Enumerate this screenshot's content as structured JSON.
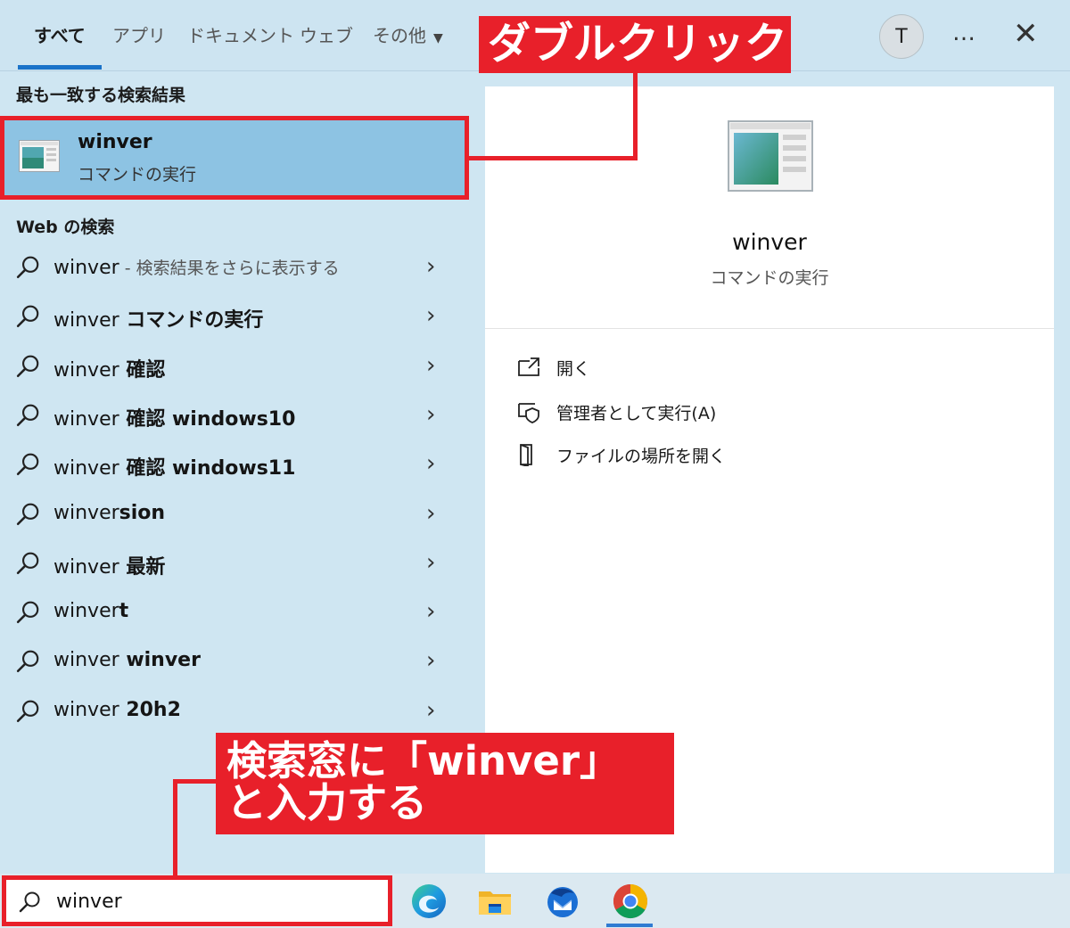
{
  "tabs": [
    {
      "label": "すべて",
      "active": true
    },
    {
      "label": "アプリ"
    },
    {
      "label": "ドキュメント"
    },
    {
      "label": "ウェブ"
    },
    {
      "label": "その他",
      "dropdown": true
    }
  ],
  "account": {
    "initial": "T"
  },
  "more_label": "…",
  "close_label": "✕",
  "best_match": {
    "heading": "最も一致する検索結果",
    "title": "winver",
    "subtitle": "コマンドの実行"
  },
  "web": {
    "heading": "Web の検索",
    "items": [
      {
        "query": "winver",
        "suffix": "",
        "hint": " - 検索結果をさらに表示する"
      },
      {
        "query": "winver",
        "suffix": " コマンドの実行",
        "hint": ""
      },
      {
        "query": "winver",
        "suffix": " 確認",
        "hint": ""
      },
      {
        "query": "winver",
        "suffix": " 確認 windows10",
        "hint": ""
      },
      {
        "query": "winver",
        "suffix": " 確認 windows11",
        "hint": ""
      },
      {
        "query": "winver",
        "suffix": "sion",
        "hint": ""
      },
      {
        "query": "winver",
        "suffix": " 最新",
        "hint": ""
      },
      {
        "query": "winver",
        "suffix": "t",
        "hint": ""
      },
      {
        "query": "winver",
        "suffix": " winver",
        "hint": ""
      },
      {
        "query": "winver",
        "suffix": " 20h2",
        "hint": ""
      }
    ]
  },
  "detail": {
    "title": "winver",
    "subtitle": "コマンドの実行",
    "actions": [
      {
        "label": "開く",
        "icon": "open-icon"
      },
      {
        "label": "管理者として実行(A)",
        "icon": "shield-icon"
      },
      {
        "label": "ファイルの場所を開く",
        "icon": "folder-icon"
      }
    ]
  },
  "search": {
    "value": "winver"
  },
  "taskbar_apps": [
    "edge-icon",
    "file-explorer-icon",
    "thunderbird-icon",
    "chrome-icon"
  ],
  "annotations": {
    "double_click": "ダブルクリック",
    "type_line1": "検索窓に「winver」",
    "type_line2": "と入力する"
  },
  "colors": {
    "accent_red": "#e8202a",
    "selection_blue": "#8dc3e3",
    "panel_blue": "#cfe6f2",
    "tab_underline": "#1a73c9"
  }
}
